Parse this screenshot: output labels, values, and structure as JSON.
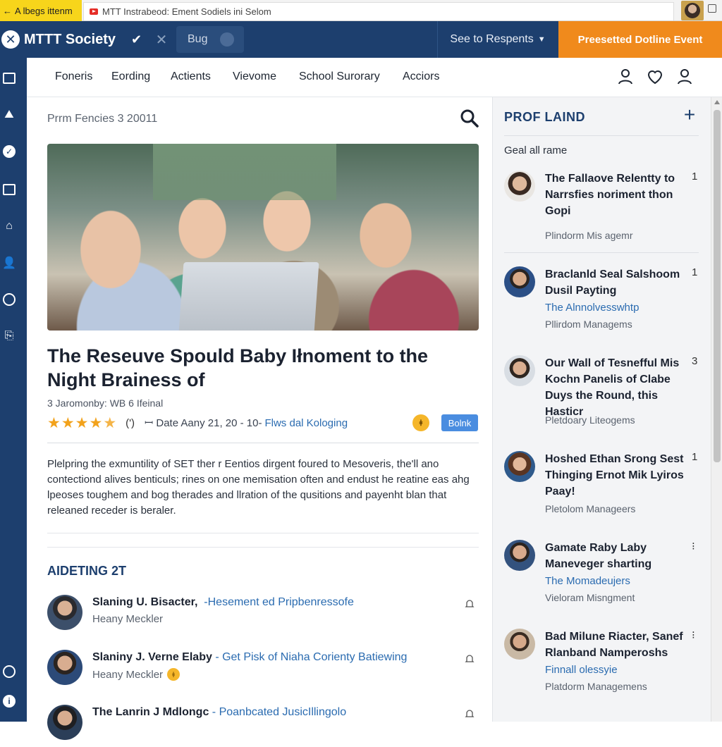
{
  "browser": {
    "tab_left_label": "A lbegs ittenm",
    "tab_main_title": "MTT Instrabeod: Ement Sodiels ini Selom"
  },
  "appbar": {
    "brand_name": "MTTT Society",
    "bug_label": "Bug",
    "respond_label": "See to Respents",
    "event_button": "Preesetted Dotline Event"
  },
  "nav": {
    "items": [
      "Foneris",
      "Eording",
      "Actients",
      "Vievome",
      "School Surorary",
      "Acciors"
    ]
  },
  "main": {
    "breadcrumb": "Prrm Fencies 3 20011",
    "title": "The Reseuve Spould Baby Iłnoment to the Night Brainess of",
    "meta": "3 Jaromonby: WB 6 Ifeinal",
    "rating_stars": 4.5,
    "rating_paren": "(')",
    "rating_date": "ꟷ Date Aany 21, 20 - 10-",
    "rating_link": "Flws dal Kologing",
    "badge_icon_text": "ꬸ",
    "badge_button": "Bolnk",
    "body": "Plelpring the exmuntility of SET ther r Eentios dirgent foured to Mesoveris, the'll ano contectiond alives benticuls; rines on one memisation often and endust he reatine eas ahg lpeoses toughem and bog therades and llration of the qusitions and payenht blan that releaned receder is beraler.",
    "section_title": "AIDETING 2T",
    "comments": [
      {
        "name": "Slaning U. Bisacter,",
        "link": "-Hesement ed Pripbenressofe",
        "sub": "Heany Meckler",
        "coin": false
      },
      {
        "name": "Slaniny J. Verne Elaby",
        "link": "- Get Pisk of Niaha Corienty Batiewing",
        "sub": "Heany Meckler",
        "coin": true
      },
      {
        "name": "The Lanrin J Mdlongc",
        "link": "- Poanbcated JusicIllingolo",
        "sub": "",
        "coin": false
      }
    ]
  },
  "sidebar": {
    "title": "PROF LAIND",
    "subtitle": "Geal all rame",
    "items": [
      {
        "headline": "The Fallaove Relentty to Narrsfies noriment thon Gopi",
        "count": "1",
        "link": "",
        "role": "Plindorm Mis agemr"
      },
      {
        "headline": "Braclanld Seal Salshoom Dusil Payting",
        "count": "1",
        "link": "The Alnnolvesswhtp",
        "role": "Pllirdom Managems"
      },
      {
        "headline": "Our Wall of Tesnefful Mis Kochn Panelis of Clabe Duys the Round, this Hasticr",
        "count": "3",
        "link": "",
        "role": "Pletdoary Liteogems"
      },
      {
        "headline": "Hoshed Ethan Srong Sest Thinging Ernot Mik Lyiros Paay!",
        "count": "1",
        "link": "",
        "role": "Pletolom Manageers"
      },
      {
        "headline": "Gamate Raby Laby Maneveger sharting",
        "count": "⁝",
        "link": "The Momadeujers",
        "role": "Vieloram Misngment"
      },
      {
        "headline": "Bad Milune Riacter, Sanef Rlanband Namperoshs",
        "count": "⁝",
        "link": "Finnall olessyie",
        "role": "Platdorm Managemens"
      }
    ]
  },
  "colors": {
    "brand_navy": "#1d3f6e",
    "accent_orange": "#f08a1c",
    "link_blue": "#2a6bb0",
    "star_gold": "#f2a21b"
  }
}
